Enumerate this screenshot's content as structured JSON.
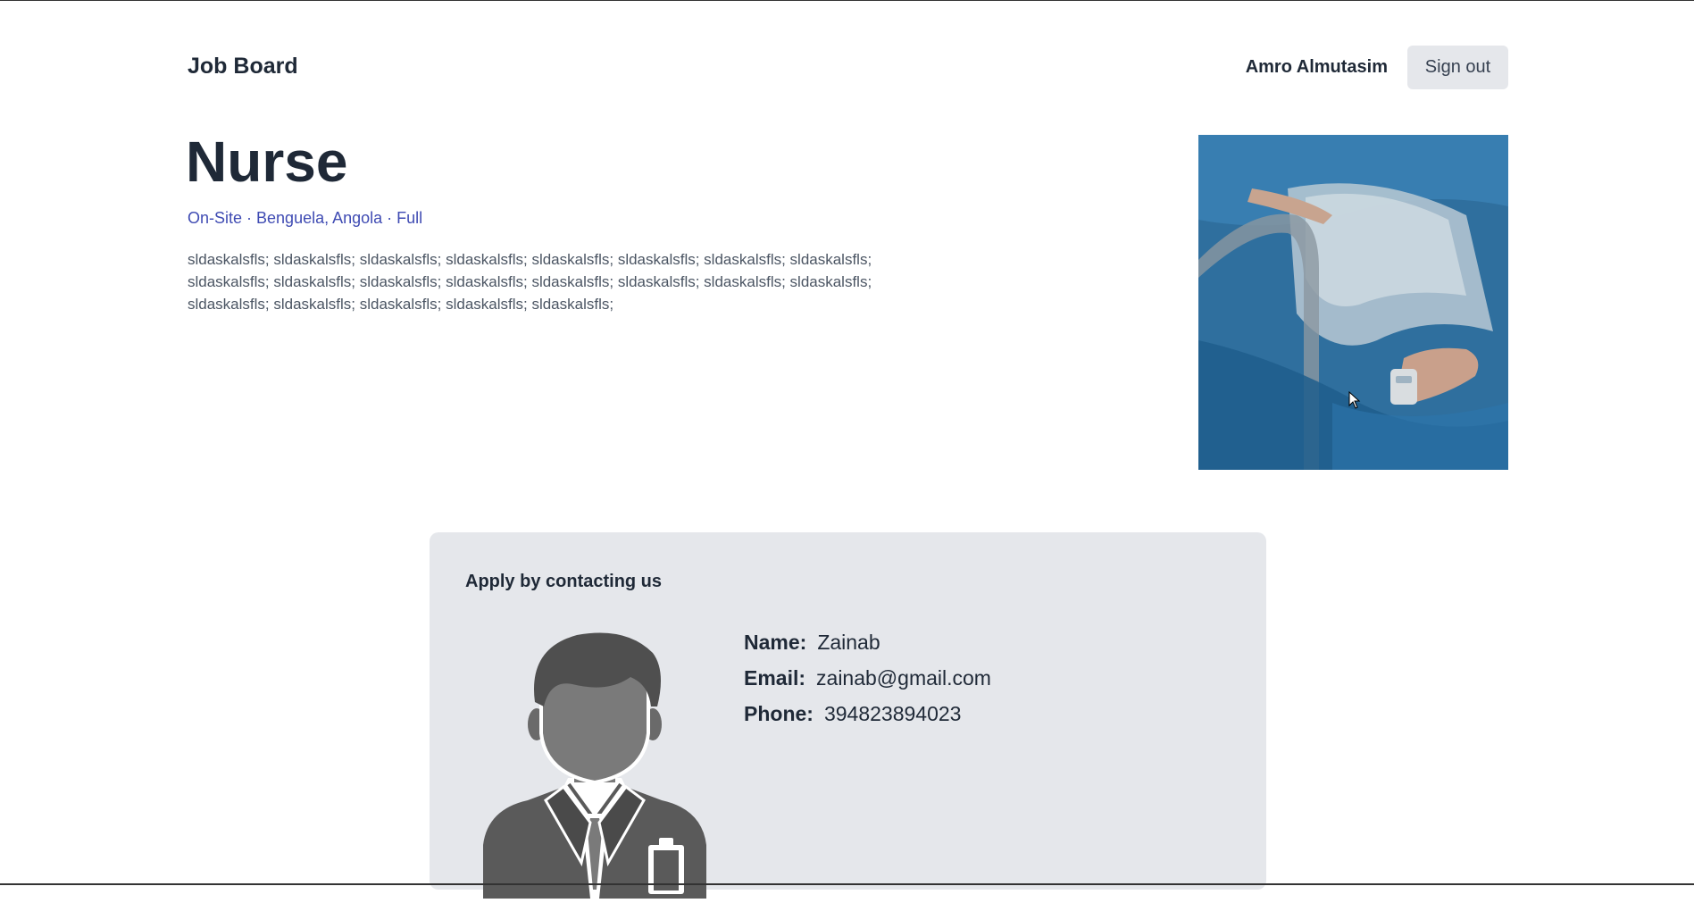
{
  "header": {
    "brand": "Job Board",
    "user_name": "Amro Almutasim",
    "signout_label": "Sign out"
  },
  "job": {
    "title": "Nurse",
    "workplace": "On-Site",
    "location": "Benguela, Angola",
    "type": "Full",
    "separator": " · ",
    "description": "sldaskalsfls; sldaskalsfls; sldaskalsfls; sldaskalsfls; sldaskalsfls; sldaskalsfls; sldaskalsfls; sldaskalsfls; sldaskalsfls; sldaskalsfls; sldaskalsfls; sldaskalsfls; sldaskalsfls; sldaskalsfls; sldaskalsfls; sldaskalsfls; sldaskalsfls; sldaskalsfls; sldaskalsfls; sldaskalsfls; sldaskalsfls;"
  },
  "apply": {
    "heading": "Apply by contacting us",
    "name_label": "Name:",
    "name": "Zainab",
    "email_label": "Email:",
    "email": "zainab@gmail.com",
    "phone_label": "Phone:",
    "phone": "394823894023"
  },
  "icons": {
    "hero": "hospital-patient-photo",
    "avatar": "person-avatar-icon",
    "cursor": "mouse-cursor-icon"
  },
  "colors": {
    "meta": "#3f4bb3",
    "card_bg": "#e5e7eb",
    "button_bg": "#e5e7eb"
  }
}
